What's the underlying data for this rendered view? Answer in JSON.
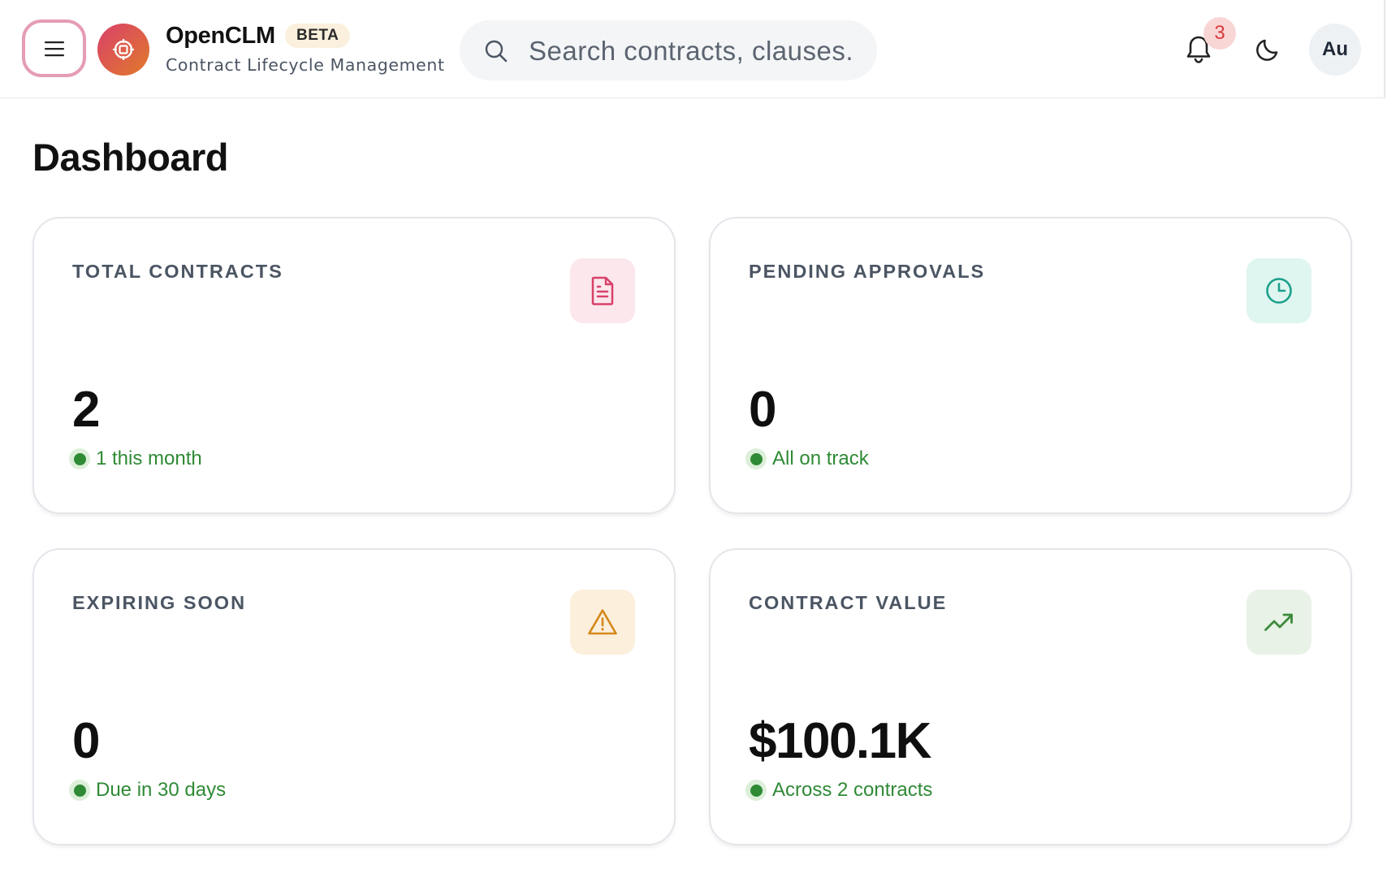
{
  "header": {
    "app_name": "OpenCLM",
    "badge": "BETA",
    "subtitle": "Contract Lifecycle Management",
    "search_placeholder": "Search contracts, clauses.",
    "notification_count": "3",
    "avatar_initials": "Au",
    "icons": {
      "menu": "hamburger-menu-icon",
      "logo": "target-logo-icon",
      "search": "search-icon",
      "notifications": "bell-icon",
      "theme": "moon-icon"
    }
  },
  "page": {
    "title": "Dashboard"
  },
  "cards": [
    {
      "label": "TOTAL CONTRACTS",
      "value": "2",
      "sub": "1 this month",
      "icon": "document-icon",
      "accent": "#d9406a",
      "icon_bg": "#fbe7ec"
    },
    {
      "label": "PENDING APPROVALS",
      "value": "0",
      "sub": "All on track",
      "icon": "clock-icon",
      "accent": "#1aa08a",
      "icon_bg": "#dff5f0"
    },
    {
      "label": "EXPIRING SOON",
      "value": "0",
      "sub": "Due in 30 days",
      "icon": "warning-icon",
      "accent": "#d4881a",
      "icon_bg": "#fcefdc"
    },
    {
      "label": "CONTRACT VALUE",
      "value": "$100.1K",
      "sub": "Across 2 contracts",
      "icon": "trending-up-icon",
      "accent": "#3c8a3c",
      "icon_bg": "#e8f2e6"
    }
  ],
  "colors": {
    "status_green": "#2f8a36",
    "menu_ring": "#e59cb6",
    "notification_badge_text": "#d93a3a"
  }
}
